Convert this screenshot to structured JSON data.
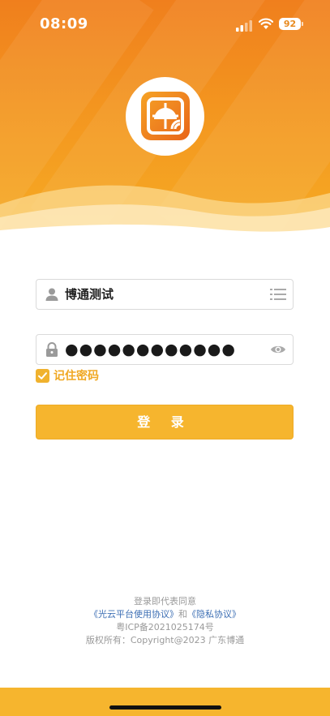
{
  "status_bar": {
    "time": "08:09",
    "battery": "92"
  },
  "form": {
    "username_value": "博通测试",
    "password_masked": "●●●●●●●●●●●●",
    "remember_label": "记住密码",
    "login_label": "登 录"
  },
  "footer": {
    "agree_text": "登录即代表同意",
    "terms_link": "《光云平台使用协议》",
    "and_text": "和",
    "privacy_link": "《隐私协议》",
    "icp": "粤ICP备2021025174号",
    "copyright": "版权所有：Copyright@2023 广东博通"
  },
  "colors": {
    "brand_orange": "#f07f1d",
    "accent_yellow": "#f6b52e",
    "link_blue": "#3d6fb4"
  },
  "icons": [
    "signal-icon",
    "wifi-icon",
    "battery-icon",
    "app-logo",
    "user-icon",
    "list-icon",
    "lock-icon",
    "eye-icon",
    "check-icon"
  ]
}
